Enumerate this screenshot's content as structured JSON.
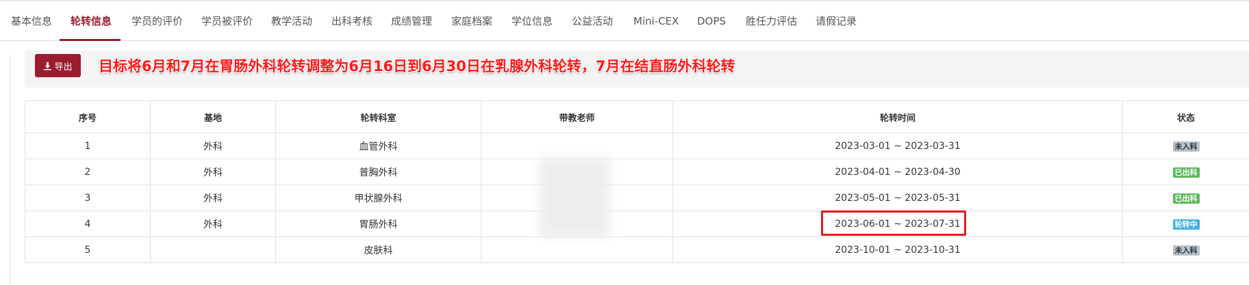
{
  "tabs": [
    {
      "label": "基本信息",
      "active": false
    },
    {
      "label": "轮转信息",
      "active": true
    },
    {
      "label": "学员的评价",
      "active": false
    },
    {
      "label": "学员被评价",
      "active": false
    },
    {
      "label": "教学活动",
      "active": false
    },
    {
      "label": "出科考核",
      "active": false
    },
    {
      "label": "成绩管理",
      "active": false
    },
    {
      "label": "家庭档案",
      "active": false
    },
    {
      "label": "学位信息",
      "active": false
    },
    {
      "label": "公益活动",
      "active": false
    },
    {
      "label": "Mini-CEX",
      "active": false
    },
    {
      "label": "DOPS",
      "active": false
    },
    {
      "label": "胜任力评估",
      "active": false
    },
    {
      "label": "请假记录",
      "active": false
    }
  ],
  "toolbar": {
    "export_label": "导出",
    "export_icon": "download-icon"
  },
  "annotation": "目标将6月和7月在胃肠外科轮转调整为6月16日到6月30日在乳腺外科轮转，7月在结直肠外科轮转",
  "table": {
    "headers": [
      "序号",
      "基地",
      "轮转科室",
      "带教老师",
      "轮转时间",
      "状态"
    ],
    "rows": [
      {
        "no": "1",
        "base": "外科",
        "dept": "血管外科",
        "teacher": "",
        "time": "2023-03-01 ~ 2023-03-31",
        "status": "未入科",
        "status_color": "#b9c3cc"
      },
      {
        "no": "2",
        "base": "外科",
        "dept": "普胸外科",
        "teacher": "",
        "time": "2023-04-01 ~ 2023-04-30",
        "status": "已出科",
        "status_color": "#5cb85c"
      },
      {
        "no": "3",
        "base": "外科",
        "dept": "甲状腺外科",
        "teacher": "",
        "time": "2023-05-01 ~ 2023-05-31",
        "status": "已出科",
        "status_color": "#5cb85c"
      },
      {
        "no": "4",
        "base": "外科",
        "dept": "胃肠外科",
        "teacher": "",
        "time": "2023-06-01 ~ 2023-07-31",
        "status": "轮转中",
        "status_color": "#3fb0e6"
      },
      {
        "no": "5",
        "base": "",
        "dept": "皮肤科",
        "teacher": "",
        "time": "2023-10-01 ~ 2023-10-31",
        "status": "未入科",
        "status_color": "#b9c3cc"
      }
    ]
  },
  "colors": {
    "accent": "#9b1c2e",
    "annotation": "#ff1a1a",
    "highlight": "#e11b1b"
  }
}
